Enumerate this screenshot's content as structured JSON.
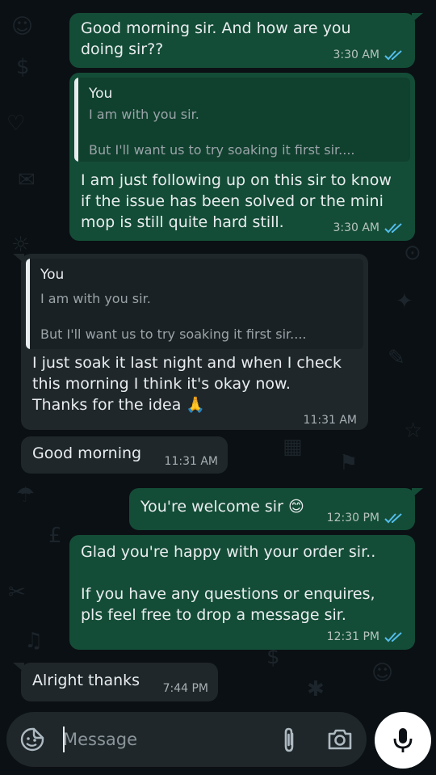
{
  "messages": [
    {
      "direction": "outgoing",
      "text": "Good morning sir. And how are you\ndoing sir??",
      "time": "3:30 AM",
      "status": "read"
    },
    {
      "direction": "outgoing",
      "quote": {
        "author": "You",
        "lines": [
          "I am with you sir.",
          "",
          "But I'll want us to try soaking it first sir...."
        ]
      },
      "text": "I am just following up on this sir to know\nif the issue has been solved or the mini\nmop is still quite hard still.",
      "time": "3:30 AM",
      "status": "read"
    },
    {
      "direction": "incoming",
      "quote": {
        "author": "You",
        "lines": [
          "I am with you sir.",
          "",
          "But I'll want us to try soaking it first sir...."
        ]
      },
      "text": "I just soak it last night and when I check\nthis morning I think it's okay now.\nThanks for the idea 🙏",
      "time": "11:31 AM"
    },
    {
      "direction": "incoming",
      "text": "Good morning",
      "time": "11:31 AM"
    },
    {
      "direction": "outgoing",
      "text": "You're welcome sir 😊",
      "time": "12:30 PM",
      "status": "read"
    },
    {
      "direction": "outgoing",
      "text": "Glad you're happy with your order sir..\n\nIf you have any questions or enquires,\npls feel free to drop a message sir.",
      "time": "12:31 PM",
      "status": "read"
    },
    {
      "direction": "incoming",
      "text": "Alright thanks",
      "time": "7:44 PM"
    }
  ],
  "composer": {
    "placeholder": "Message"
  },
  "icons": {
    "emoji": "emoji-sticker-icon",
    "attach": "paperclip-icon",
    "camera": "camera-icon",
    "mic": "microphone-icon",
    "ticks": "double-check-icon"
  },
  "colors": {
    "outgoing_bubble": "#144d37",
    "incoming_bubble": "#1f272b",
    "background": "#0b1014",
    "read_ticks": "#53bdeb"
  }
}
